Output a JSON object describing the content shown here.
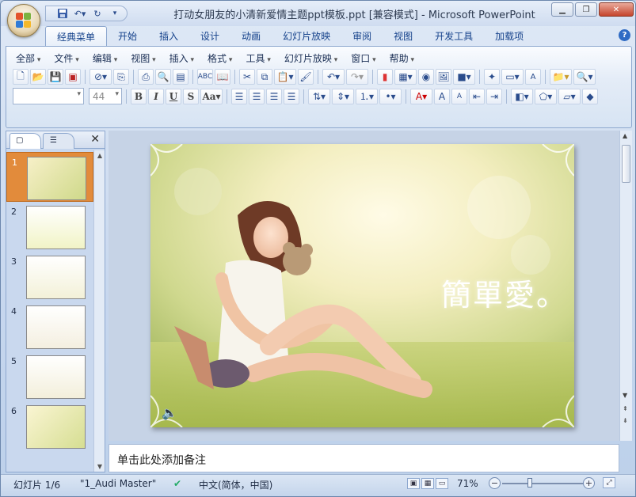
{
  "window": {
    "title": "打动女朋友的小清新爱情主题ppt模板.ppt [兼容模式] - Microsoft PowerPoint"
  },
  "ribbon": {
    "tabs": [
      {
        "label": "经典菜单",
        "active": true
      },
      {
        "label": "开始"
      },
      {
        "label": "插入"
      },
      {
        "label": "设计"
      },
      {
        "label": "动画"
      },
      {
        "label": "幻灯片放映"
      },
      {
        "label": "审阅"
      },
      {
        "label": "视图"
      },
      {
        "label": "开发工具"
      },
      {
        "label": "加载项"
      }
    ],
    "menus": [
      "全部",
      "文件",
      "编辑",
      "视图",
      "插入",
      "格式",
      "工具",
      "幻灯片放映",
      "窗口",
      "帮助"
    ],
    "font_size_value": "44"
  },
  "slides_panel": {
    "slide_numbers": [
      "1",
      "2",
      "3",
      "4",
      "5",
      "6"
    ],
    "selected": 1
  },
  "slide": {
    "title_text": "簡單愛。"
  },
  "notes": {
    "placeholder": "单击此处添加备注"
  },
  "status_bar": {
    "slide_info": "幻灯片 1/6",
    "theme": "\"1_Audi Master\"",
    "language": "中文(简体，中国)",
    "zoom": "71%"
  },
  "colors": {
    "accent": "#15428b",
    "selected_thumb": "#e28b3b"
  }
}
